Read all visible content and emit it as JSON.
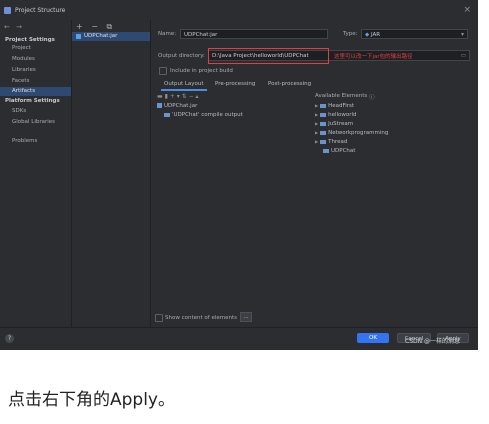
{
  "window": {
    "title": "Project Structure",
    "close_glyph": "×"
  },
  "left_nav": {
    "arrows": "← →",
    "sections": [
      {
        "title": "Project Settings",
        "items": [
          "Project",
          "Modules",
          "Libraries",
          "Facets",
          "Artifacts"
        ]
      },
      {
        "title": "Platform Settings",
        "items": [
          "SDKs",
          "Global Libraries"
        ]
      }
    ],
    "problems": "Problems",
    "selected": "Artifacts"
  },
  "artifact_list": {
    "tools": "+ − ⧉",
    "selected_item": "UDPChat:jar"
  },
  "detail": {
    "name_label": "Name:",
    "name_value": "UDPChat:jar",
    "type_label": "Type:",
    "type_value": "JAR",
    "output_label": "Output directory:",
    "output_value": "D:\\Java Project\\helloworld\\UDPChat",
    "annotation": "这里可以改一下jar包的输出路径",
    "include_label": "Include in project build",
    "tabs": [
      "Output Layout",
      "Pre-processing",
      "Post-processing"
    ],
    "active_tab": "Output Layout",
    "layout_tree": [
      "UDPChat.jar",
      "'UDPChat' compile output"
    ],
    "available_title": "Available Elements",
    "available_items": [
      "HeadFirst",
      "helloworld",
      "JuStream",
      "Networkprogramming",
      "Thread",
      "UDPChat"
    ],
    "show_content_label": "Show content of elements",
    "more_button": "..."
  },
  "footer": {
    "help": "?",
    "ok": "OK",
    "cancel": "Cancel",
    "apply": "Apply",
    "watermark": "CSDN @一样的消息"
  },
  "caption": "点击右下角的Apply。",
  "colors": {
    "bg": "#2b2d30",
    "selection": "#2e4a73",
    "accent": "#3574f0",
    "annotation_red": "#e04040"
  }
}
